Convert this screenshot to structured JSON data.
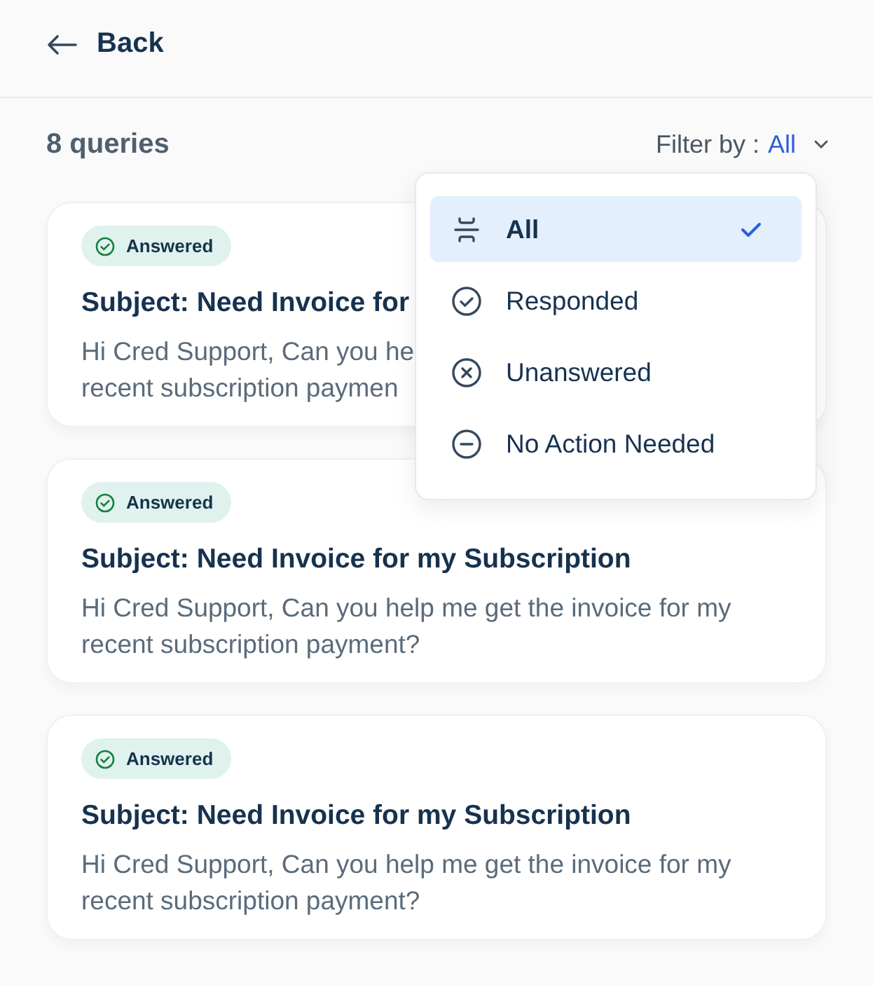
{
  "header": {
    "back_label": "Back"
  },
  "summary": {
    "count": "8 queries",
    "filter_label": "Filter by :",
    "filter_value": "All"
  },
  "queries": [
    {
      "status": {
        "kind": "answered",
        "label": "Answered"
      },
      "subject": "Subject: Need Invoice for",
      "body": "Hi Cred Support, Can you he\nrecent subscription paymen"
    },
    {
      "status": {
        "kind": "answered",
        "label": "Answered"
      },
      "subject": "Subject: Need Invoice for my Subscription",
      "body": "Hi Cred Support, Can you help me get the invoice for my\nrecent subscription payment?"
    },
    {
      "status": {
        "kind": "answered",
        "label": "Answered"
      },
      "subject": "Subject: Need Invoice for my Subscription",
      "body": "Hi Cred Support, Can you help me get the invoice for my\nrecent subscription payment?"
    }
  ],
  "filter_menu": {
    "items": [
      {
        "kind": "all",
        "label": "All",
        "selected": true
      },
      {
        "kind": "responded",
        "label": "Responded",
        "selected": false
      },
      {
        "kind": "unanswered",
        "label": "Unanswered",
        "selected": false
      },
      {
        "kind": "none",
        "label": "No Action Needed",
        "selected": false
      }
    ]
  }
}
